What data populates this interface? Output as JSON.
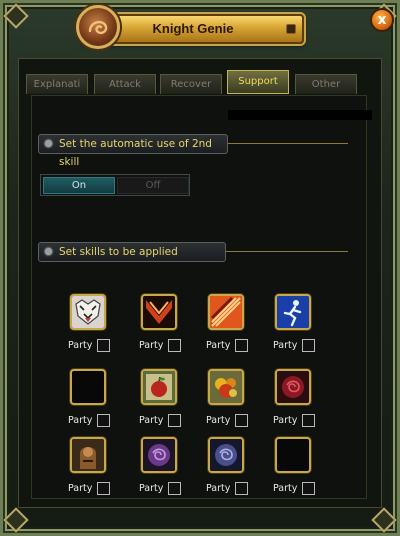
{
  "window": {
    "title": "Knight Genie",
    "close_label": "x"
  },
  "tabs": [
    {
      "label": "Explanati",
      "active": false
    },
    {
      "label": "Attack",
      "active": false
    },
    {
      "label": "Recover",
      "active": false
    },
    {
      "label": "Support",
      "active": true
    },
    {
      "label": "Other",
      "active": false
    }
  ],
  "section_auto": {
    "label": "Set the automatic use of 2nd skill",
    "toggle": {
      "on_label": "On",
      "off_label": "Off",
      "selected": "On"
    }
  },
  "section_skills": {
    "label": "Set skills to be applied"
  },
  "skills": [
    {
      "icon": "tiger-skill-icon",
      "party_label": "Party",
      "checked": false
    },
    {
      "icon": "red-slash-skill-icon",
      "party_label": "Party",
      "checked": false
    },
    {
      "icon": "fire-strike-skill-icon",
      "party_label": "Party",
      "checked": false
    },
    {
      "icon": "running-figure-skill-icon",
      "party_label": "Party",
      "checked": false
    },
    {
      "icon": "empty-slot",
      "party_label": "Party",
      "checked": false
    },
    {
      "icon": "apple-item-icon",
      "party_label": "Party",
      "checked": false
    },
    {
      "icon": "fruit-basket-item-icon",
      "party_label": "Party",
      "checked": false
    },
    {
      "icon": "red-rose-item-icon",
      "party_label": "Party",
      "checked": false
    },
    {
      "icon": "knight-portrait-icon",
      "party_label": "Party",
      "checked": false
    },
    {
      "icon": "purple-rose-item-icon",
      "party_label": "Party",
      "checked": false
    },
    {
      "icon": "blue-rose-item-icon",
      "party_label": "Party",
      "checked": false
    },
    {
      "icon": "empty-slot",
      "party_label": "Party",
      "checked": false
    }
  ],
  "colors": {
    "accent_gold": "#c7a94b",
    "label_yellow": "#e8d66a",
    "toggle_on": "#1f5c62"
  }
}
